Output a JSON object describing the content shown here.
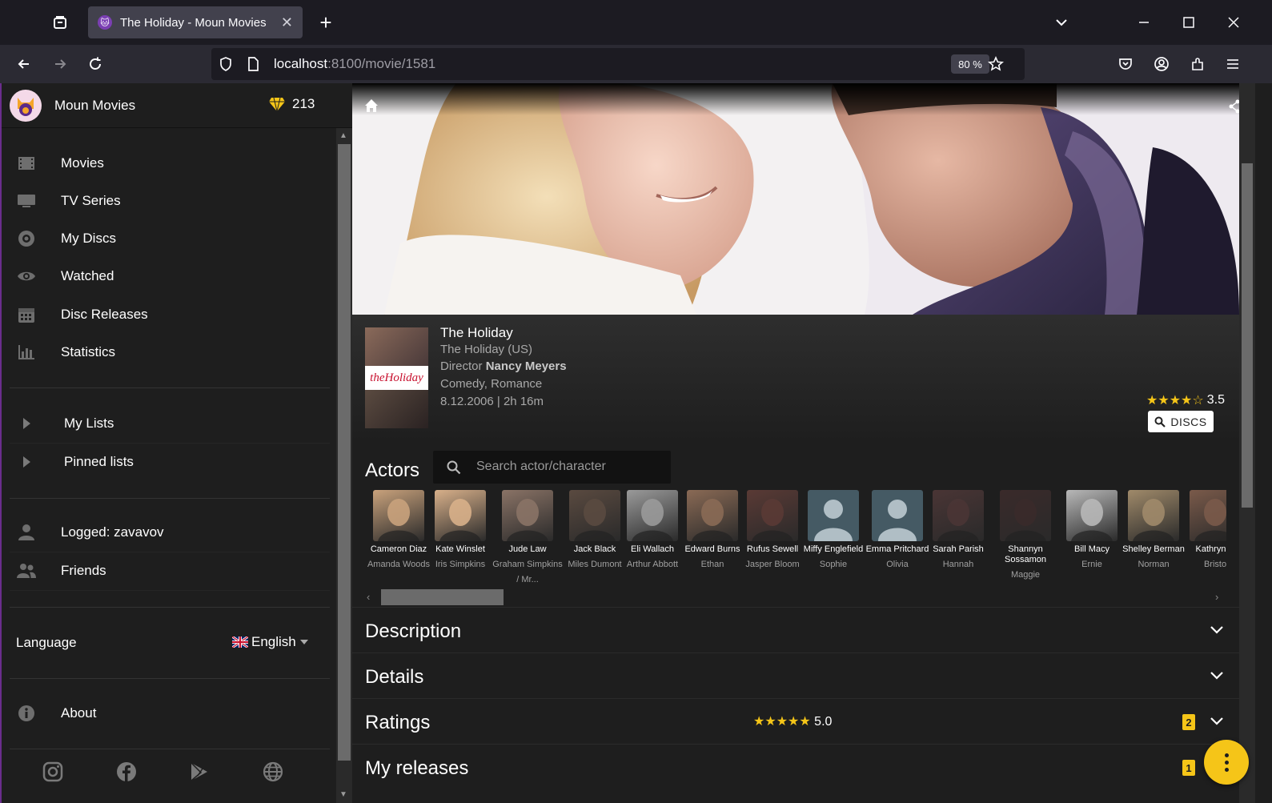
{
  "browser": {
    "tab_title": "The Holiday - Moun Movies",
    "url_host": "localhost",
    "url_rest": ":8100/movie/1581",
    "zoom": "80 %"
  },
  "sidebar": {
    "app_name": "Moun Movies",
    "gems": "213",
    "nav": [
      {
        "label": "Movies",
        "icon": "film-icon"
      },
      {
        "label": "TV Series",
        "icon": "tv-icon"
      },
      {
        "label": "My Discs",
        "icon": "disc-icon"
      },
      {
        "label": "Watched",
        "icon": "eye-icon"
      },
      {
        "label": "Disc Releases",
        "icon": "calendar-icon"
      },
      {
        "label": "Statistics",
        "icon": "bar-chart-icon"
      }
    ],
    "lists": [
      {
        "label": "My Lists"
      },
      {
        "label": "Pinned lists"
      }
    ],
    "account": [
      {
        "label": "Logged: zavavov",
        "icon": "user-icon"
      },
      {
        "label": "Friends",
        "icon": "friends-icon"
      }
    ],
    "language_label": "Language",
    "language_value": "English",
    "about_label": "About",
    "social": [
      "instagram-icon",
      "facebook-icon",
      "play-store-icon",
      "globe-icon"
    ]
  },
  "movie": {
    "title": "The Holiday",
    "original_title": "The Holiday (US)",
    "director_label": "Director",
    "director": "Nancy Meyers",
    "genres": "Comedy, Romance",
    "release_runtime": "8.12.2006 | 2h 16m",
    "poster_text": "theHoliday",
    "rating_stars": "★★★★☆",
    "rating_value": "3.5",
    "discs_button": "DISCS"
  },
  "actors": {
    "title": "Actors",
    "search_placeholder": "Search actor/character",
    "list": [
      {
        "name": "Cameron Diaz",
        "character": "Amanda Woods",
        "color": "#c9a27c"
      },
      {
        "name": "Kate Winslet",
        "character": "Iris Simpkins",
        "color": "#d8b08a"
      },
      {
        "name": "Jude Law",
        "character": "Graham Simpkins / Mr...",
        "color": "#8a7366"
      },
      {
        "name": "Jack Black",
        "character": "Miles Dumont",
        "color": "#5a4a40"
      },
      {
        "name": "Eli Wallach",
        "character": "Arthur Abbott",
        "color": "#9a9a9a"
      },
      {
        "name": "Edward Burns",
        "character": "Ethan",
        "color": "#8a6a55"
      },
      {
        "name": "Rufus Sewell",
        "character": "Jasper Bloom",
        "color": "#5a3a35"
      },
      {
        "name": "Miffy Englefield",
        "character": "Sophie",
        "color": "placeholder"
      },
      {
        "name": "Emma Pritchard",
        "character": "Olivia",
        "color": "placeholder"
      },
      {
        "name": "Sarah Parish",
        "character": "Hannah",
        "color": "#4a3535"
      },
      {
        "name": "Shannyn Sossamon",
        "character": "Maggie",
        "color": "#3a2a2a"
      },
      {
        "name": "Bill Macy",
        "character": "Ernie",
        "color": "#b8b8b8"
      },
      {
        "name": "Shelley Berman",
        "character": "Norman",
        "color": "#a08a6a"
      },
      {
        "name": "Kathryn H",
        "character": "Bristo",
        "color": "#7a5a4a"
      }
    ]
  },
  "sections": {
    "description": "Description",
    "details": "Details",
    "ratings": "Ratings",
    "ratings_stars": "★★★★★",
    "ratings_value": "5.0",
    "ratings_badge": "2",
    "my_releases": "My releases",
    "my_releases_badge": "1"
  },
  "colors": {
    "accent": "#f5c518",
    "sidebar_bg": "#1e1e1e",
    "chrome_bg": "#2b2a33"
  }
}
